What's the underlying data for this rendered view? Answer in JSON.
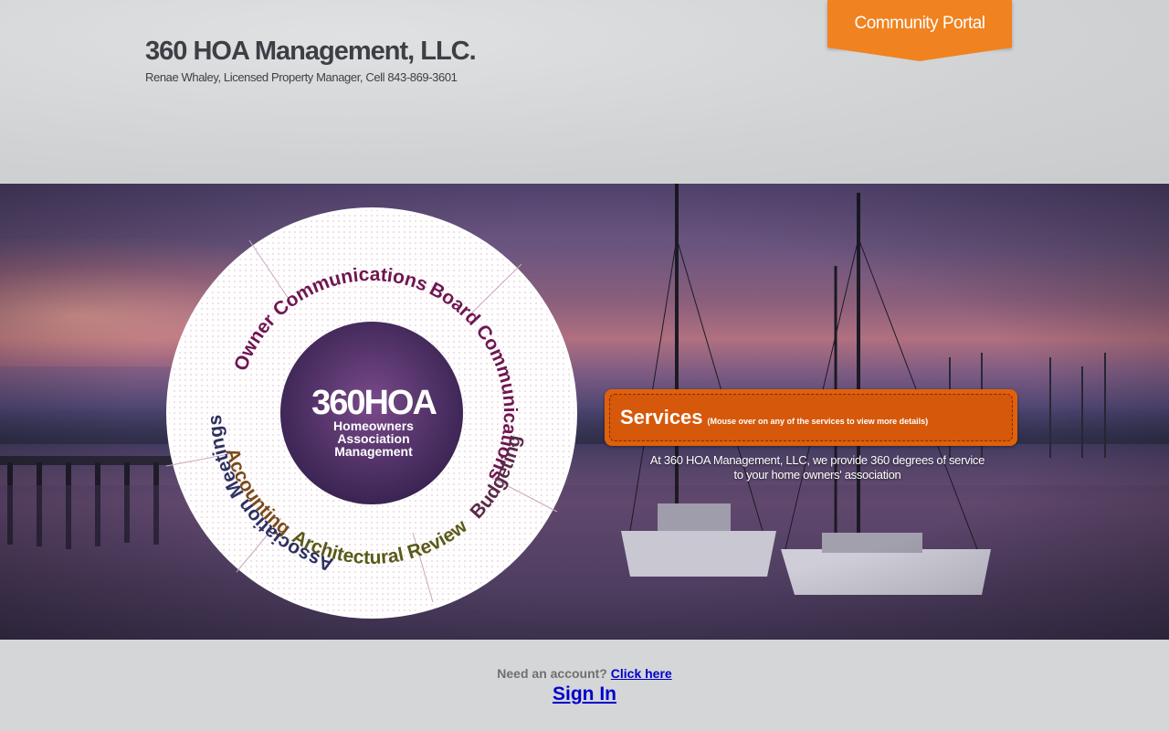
{
  "header": {
    "title": "360 HOA Management, LLC.",
    "subtitle": "Renae Whaley, Licensed Property Manager, Cell 843-869-3601",
    "portal_label": "Community Portal"
  },
  "wheel": {
    "center_title": "360HOA",
    "center_sub_1": "Homeowners",
    "center_sub_2": "Association",
    "center_sub_3": "Management",
    "services": [
      {
        "label": "Owner Communications",
        "color": "#6e1650"
      },
      {
        "label": "Board Communications",
        "color": "#6e1650"
      },
      {
        "label": "Accounting",
        "color": "#7a4a1a"
      },
      {
        "label": "Architectural Review",
        "color": "#5a5a1a"
      },
      {
        "label": "Budgeting",
        "color": "#5a2a4a"
      },
      {
        "label": "Association Meetings",
        "color": "#2e3060"
      }
    ]
  },
  "services_panel": {
    "title": "Services",
    "hint": "(Mouse over on any of the services to view more details)",
    "desc_line_1": "At 360 HOA Management, LLC, we provide 360 degrees of service",
    "desc_line_2": "to your home owners' association"
  },
  "footer": {
    "need_account": "Need an account?",
    "click_here": "Click here",
    "sign_in": "Sign In"
  },
  "colors": {
    "accent_orange": "#f0821f",
    "services_orange": "#e0600c",
    "link_blue": "#0000cc",
    "title_gray": "#3d3f45"
  }
}
